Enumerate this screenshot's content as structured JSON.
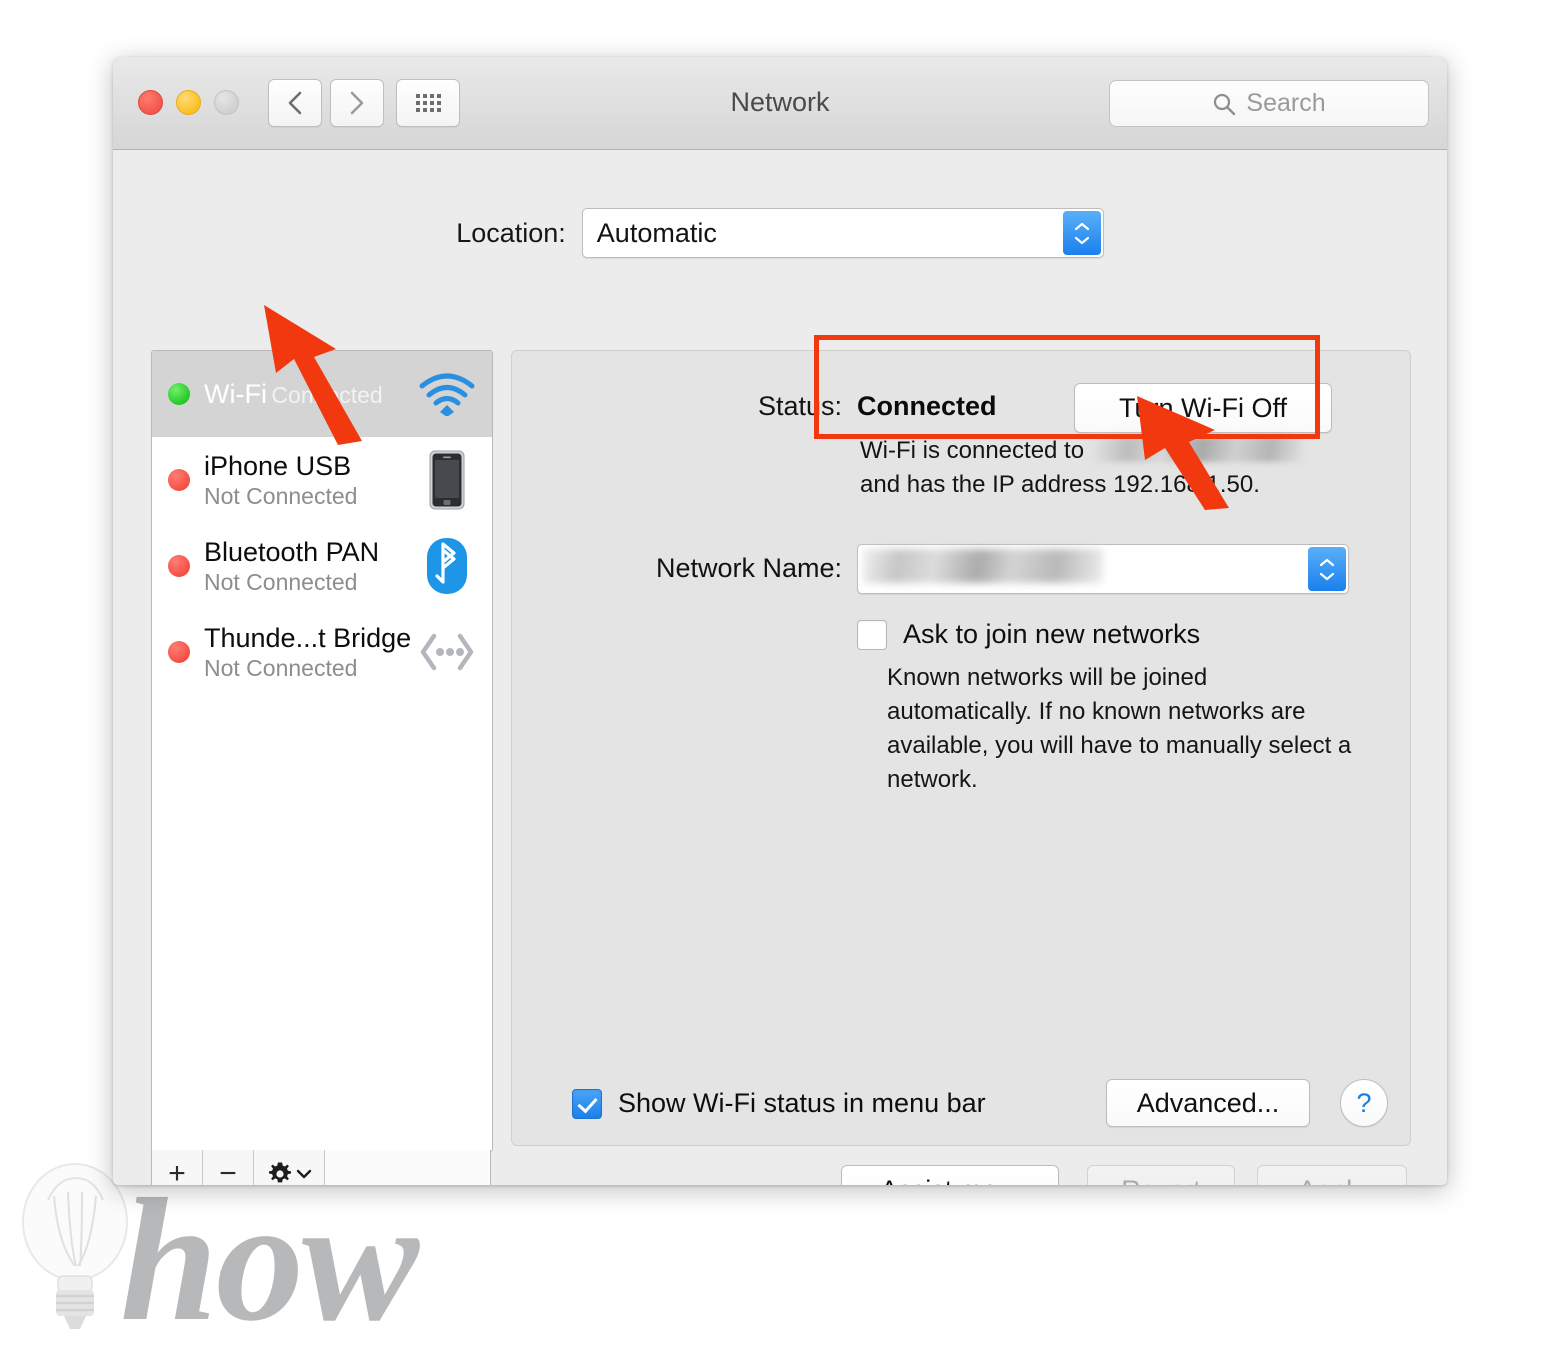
{
  "window": {
    "title": "Network",
    "search_placeholder": "Search"
  },
  "location": {
    "label": "Location:",
    "value": "Automatic"
  },
  "sidebar": {
    "services": [
      {
        "name": "Wi-Fi",
        "status": "Connected",
        "state": "connected",
        "icon": "wifi-icon",
        "selected": true
      },
      {
        "name": "iPhone USB",
        "status": "Not Connected",
        "state": "disconnected",
        "icon": "iphone-icon",
        "selected": false
      },
      {
        "name": "Bluetooth PAN",
        "status": "Not Connected",
        "state": "disconnected",
        "icon": "bluetooth-icon",
        "selected": false
      },
      {
        "name": "Thunde...t Bridge",
        "status": "Not Connected",
        "state": "disconnected",
        "icon": "thunderbolt-icon",
        "selected": false
      }
    ],
    "footer": {
      "add": "+",
      "remove": "−",
      "actions_icon": "gear-icon"
    }
  },
  "detail": {
    "status_label": "Status:",
    "status_value": "Connected",
    "wifi_toggle_label": "Turn Wi-Fi Off",
    "status_description_prefix": "Wi-Fi is connected to",
    "status_description_middle": "and",
    "status_description_suffix": "has the IP address 192.168.1.50.",
    "network_name_label": "Network Name:",
    "ask_to_join_label": "Ask to join new networks",
    "ask_to_join_checked": false,
    "helper_text": "Known networks will be joined automatically. If no known networks are available, you will have to manually select a network.",
    "show_status_label": "Show Wi-Fi status in menu bar",
    "show_status_checked": true,
    "advanced_label": "Advanced...",
    "help_label": "?"
  },
  "footer": {
    "assist_label": "Assist me...",
    "revert_label": "Revert",
    "apply_label": "Apply"
  },
  "watermark": {
    "text": "how"
  },
  "colors": {
    "accent_blue": "#1d7fe8",
    "annotation_red": "#f2380f",
    "connected_green": "#21c523",
    "disconnected_red": "#f74b3f"
  }
}
